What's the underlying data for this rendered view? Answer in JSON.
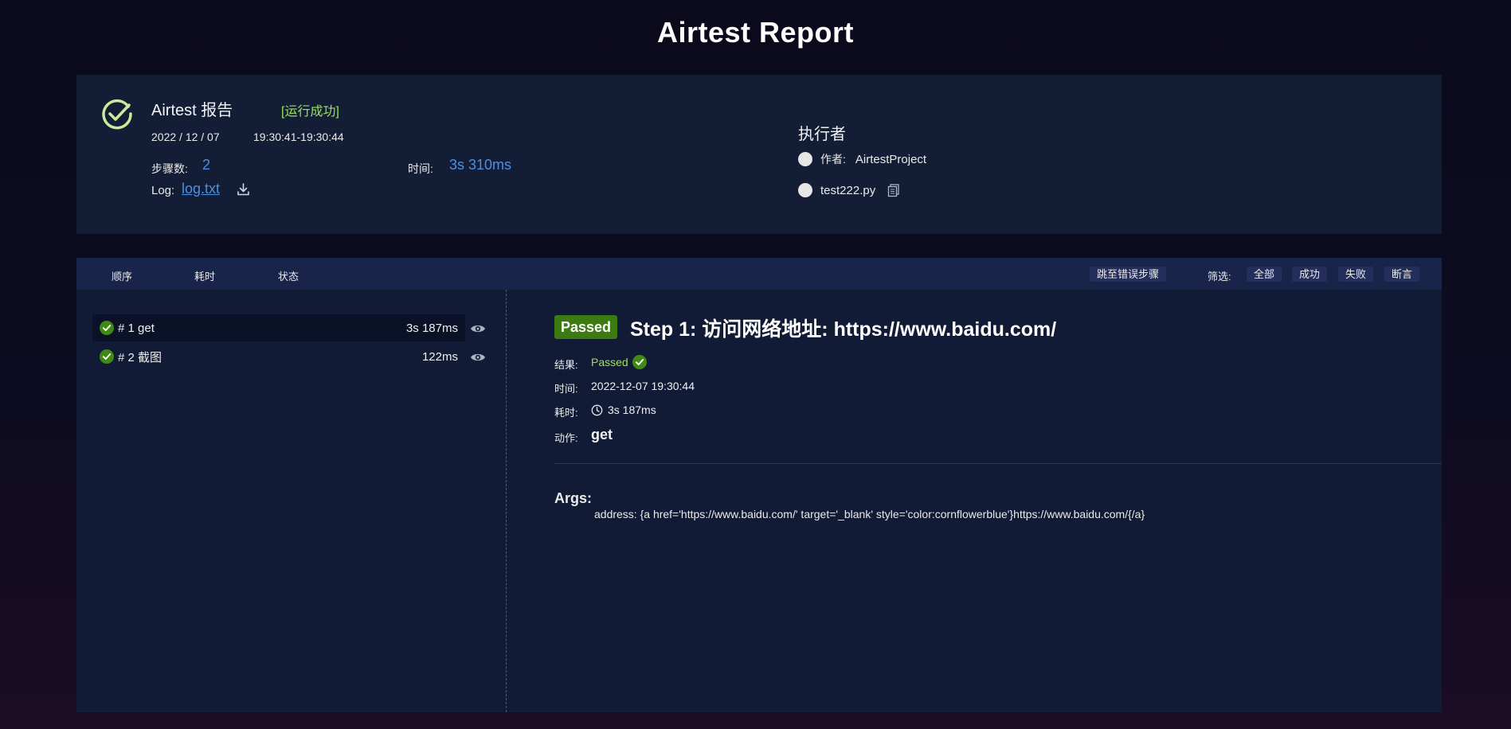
{
  "page": {
    "title": "Airtest Report"
  },
  "summary": {
    "title": "Airtest 报告",
    "status": "[运行成功]",
    "date": "2022 / 12 / 07",
    "time_range": "19:30:41-19:30:44",
    "steps_label": "步骤数:",
    "steps_value": "2",
    "duration_label": "时间:",
    "duration_value": "3s 310ms",
    "log_label": "Log:",
    "log_link": "log.txt",
    "executor_title": "执行者",
    "author_label": "作者:",
    "author_value": "AirtestProject",
    "script_name": "test222.py"
  },
  "toolbar": {
    "col_order": "顺序",
    "col_duration": "耗时",
    "col_status": "状态",
    "jump_error": "跳至错误步骤",
    "filter_label": "筛选:",
    "filter_all": "全部",
    "filter_success": "成功",
    "filter_fail": "失败",
    "filter_assert": "断言"
  },
  "steps": [
    {
      "name": "# 1 get",
      "duration": "3s 187ms"
    },
    {
      "name": "# 2 截图",
      "duration": "122ms"
    }
  ],
  "detail": {
    "badge": "Passed",
    "title": "Step 1: 访问网络地址: https://www.baidu.com/",
    "result_label": "结果:",
    "result_value": "Passed",
    "time_label": "时间:",
    "time_value": "2022-12-07 19:30:44",
    "duration_label": "耗时:",
    "duration_value": "3s 187ms",
    "action_label": "动作:",
    "action_value": "get",
    "args_title": "Args:",
    "args_line": "address: {a href='https://www.baidu.com/' target='_blank' style='color:cornflowerblue'}https://www.baidu.com/{/a}"
  },
  "colors": {
    "accent_blue": "#4a90e2",
    "success_green": "#9be35a",
    "badge_green": "#3c7a12",
    "panel_bg": "#131d36",
    "toolbar_bg": "#18244a"
  },
  "icons": [
    "check-circle-icon",
    "download-icon",
    "copy-icon",
    "check-icon",
    "eye-icon",
    "clock-icon"
  ]
}
